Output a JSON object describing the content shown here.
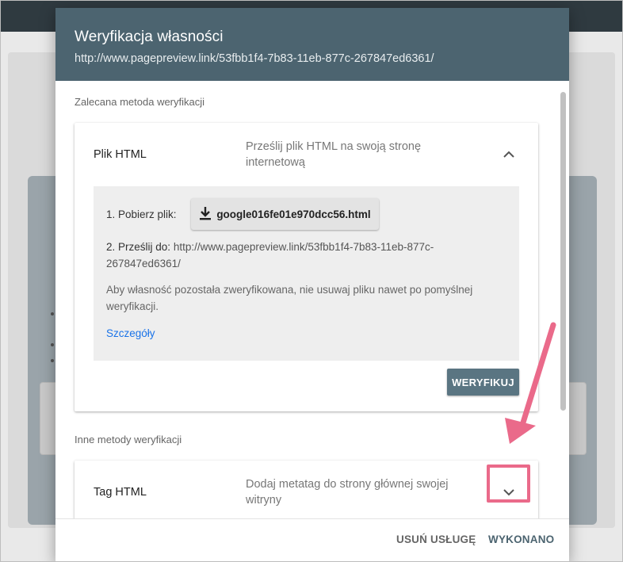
{
  "modal": {
    "title": "Weryfikacja własności",
    "url": "http://www.pagepreview.link/53fbb1f4-7b83-11eb-877c-267847ed6361/"
  },
  "recommended": {
    "section_label": "Zalecana metoda weryfikacji",
    "method": {
      "name": "Plik HTML",
      "description": "Prześlij plik HTML na swoją stronę internetową",
      "expanded": true,
      "step1_label": "1. Pobierz plik:",
      "download_filename": "google016fe01e970dcc56.html",
      "step2_label": "2. Prześlij do:",
      "upload_url": "http://www.pagepreview.link/53fbb1f4-7b83-11eb-877c-267847ed6361/",
      "note": "Aby własność pozostała zweryfikowana, nie usuwaj pliku nawet po pomyślnej weryfikacji.",
      "details_link": "Szczegóły",
      "verify_button": "WERYFIKUJ"
    }
  },
  "other": {
    "section_label": "Inne metody weryfikacji",
    "method": {
      "name": "Tag HTML",
      "description": "Dodaj metatag do strony głównej swojej witryny",
      "expanded": false
    }
  },
  "footer": {
    "remove_button": "USUŃ USŁUGĘ",
    "done_button": "WYKONANO"
  },
  "colors": {
    "header": "#4c6470",
    "verify_button": "#5a7582",
    "link": "#1a73e8",
    "annotation": "#ea6a8a"
  },
  "icons": {
    "collapse": "chevron-up-icon",
    "expand": "chevron-down-icon",
    "download": "download-icon"
  }
}
